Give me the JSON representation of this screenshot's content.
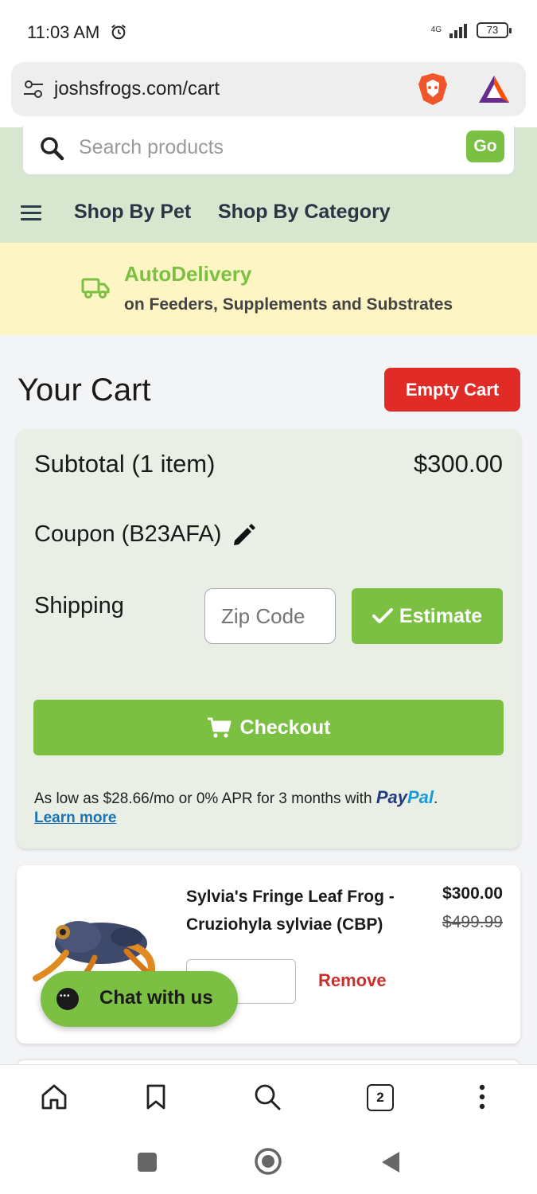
{
  "status_bar": {
    "time": "11:03 AM",
    "network": "4G",
    "battery": "73"
  },
  "browser": {
    "url": "joshsfrogs.com/cart"
  },
  "header": {
    "search_placeholder": "Search products",
    "go_label": "Go",
    "nav": [
      "Shop By Pet",
      "Shop By Category"
    ]
  },
  "banner": {
    "title": "AutoDelivery",
    "subtitle": "on Feeders, Supplements and Substrates"
  },
  "cart": {
    "title": "Your Cart",
    "empty_label": "Empty Cart",
    "subtotal_label": "Subtotal",
    "subtotal_count": "(1 item)",
    "subtotal_value": "$300.00",
    "coupon_label": "Coupon",
    "coupon_code": "(B23AFA)",
    "shipping_label": "Shipping",
    "zip_placeholder": "Zip Code",
    "estimate_label": "Estimate",
    "checkout_label": "Checkout",
    "paypal_text": "As low as $28.66/mo or 0% APR for 3 months with",
    "paypal_brand_1": "Pay",
    "paypal_brand_2": "Pal",
    "paypal_dot": ".",
    "learn_more": "Learn more"
  },
  "product": {
    "name": "Sylvia's Fringe Leaf Frog - Cruziohyla sylviae (CBP)",
    "price": "$300.00",
    "old_price": "$499.99",
    "remove_label": "Remove"
  },
  "chat": {
    "label": "Chat with us"
  },
  "toolbar": {
    "tab_count": "2"
  },
  "colors": {
    "accent_green": "#7bc043",
    "danger_red": "#e02b27",
    "banner_yellow": "#fdf5c3",
    "header_green": "#d6e6cf"
  }
}
